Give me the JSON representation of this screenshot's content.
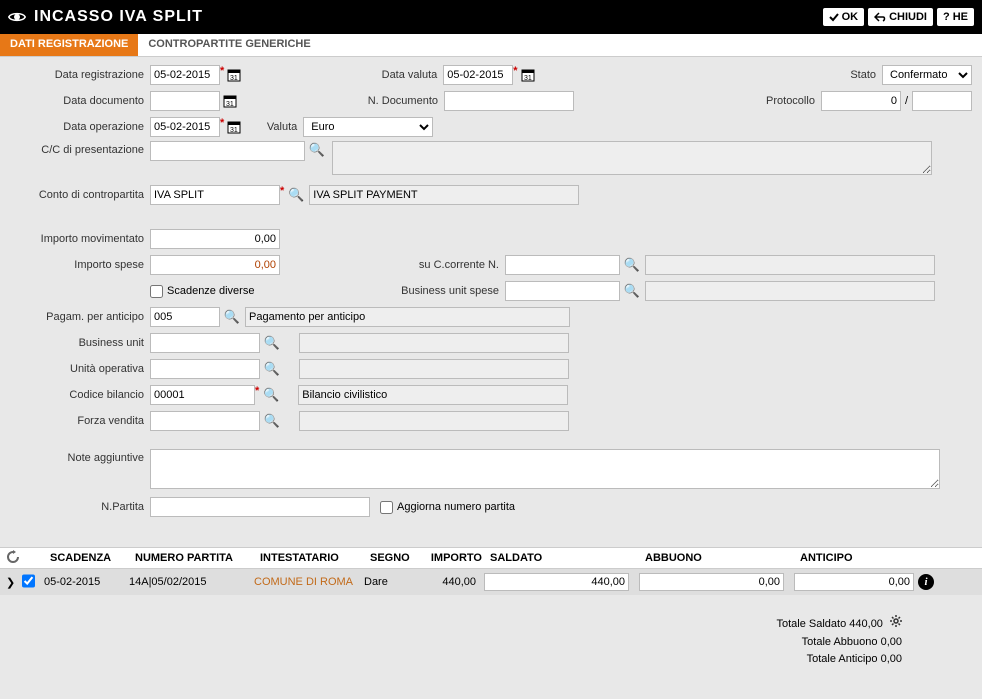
{
  "titlebar": {
    "title": "INCASSO IVA SPLIT",
    "ok_label": "OK",
    "chiudi_label": "CHIUDI",
    "he_label": "HE"
  },
  "tabs": {
    "dati_registrazione": "DATI REGISTRAZIONE",
    "contropartite_generiche": "CONTROPARTITE GENERICHE"
  },
  "labels": {
    "data_registrazione": "Data registrazione",
    "data_documento": "Data documento",
    "data_operazione": "Data operazione",
    "cc_presentazione": "C/C di presentazione",
    "data_valuta": "Data valuta",
    "n_documento": "N. Documento",
    "valuta": "Valuta",
    "stato": "Stato",
    "protocollo": "Protocollo",
    "conto_contropartita": "Conto di contropartita",
    "importo_movimentato": "Importo movimentato",
    "importo_spese": "Importo spese",
    "scadenze_diverse": "Scadenze diverse",
    "su_ccorrente_n": "su C.corrente N.",
    "business_unit_spese": "Business unit spese",
    "pagam_per_anticipo": "Pagam. per anticipo",
    "business_unit": "Business unit",
    "unita_operativa": "Unità operativa",
    "codice_bilancio": "Codice bilancio",
    "forza_vendita": "Forza vendita",
    "note_aggiuntive": "Note aggiuntive",
    "n_partita": "N.Partita",
    "aggiorna_numero_partita": "Aggiorna numero partita"
  },
  "values": {
    "data_registrazione": "05-02-2015",
    "data_documento": "",
    "data_operazione": "05-02-2015",
    "data_valuta": "05-02-2015",
    "n_documento": "",
    "valuta": "Euro",
    "stato": "Confermato",
    "protocollo_a": "0",
    "protocollo_sep": "/",
    "protocollo_b": "",
    "cc_presentazione": "",
    "cc_presentazione_desc": "",
    "conto_contropartita": "IVA SPLIT",
    "conto_contropartita_desc": "IVA SPLIT PAYMENT",
    "importo_movimentato": "0,00",
    "importo_spese": "0,00",
    "su_ccorrente_code": "",
    "su_ccorrente_desc": "",
    "bu_spese_code": "",
    "bu_spese_desc": "",
    "pagam_anticipo_code": "005",
    "pagam_anticipo_desc": "Pagamento per anticipo",
    "business_unit_code": "",
    "business_unit_desc": "",
    "unita_operativa_code": "",
    "unita_operativa_desc": "",
    "codice_bilancio_code": "00001",
    "codice_bilancio_desc": "Bilancio civilistico",
    "forza_vendita_code": "",
    "forza_vendita_desc": "",
    "note_aggiuntive": "",
    "n_partita": ""
  },
  "grid": {
    "headers": {
      "scadenza": "SCADENZA",
      "numero_partita": "NUMERO PARTITA",
      "intestatario": "INTESTATARIO",
      "segno": "SEGNO",
      "importo": "IMPORTO",
      "saldato": "SALDATO",
      "abbuono": "ABBUONO",
      "anticipo": "ANTICIPO"
    },
    "rows": [
      {
        "checked": true,
        "scadenza": "05-02-2015",
        "numero_partita": "14A|05/02/2015",
        "intestatario": "COMUNE DI ROMA",
        "segno": "Dare",
        "importo": "440,00",
        "saldato": "440,00",
        "abbuono": "0,00",
        "anticipo": "0,00"
      }
    ]
  },
  "totals": {
    "saldato_label": "Totale Saldato",
    "saldato_value": "440,00",
    "abbuono_label": "Totale Abbuono",
    "abbuono_value": "0,00",
    "anticipo_label": "Totale Anticipo",
    "anticipo_value": "0,00"
  }
}
